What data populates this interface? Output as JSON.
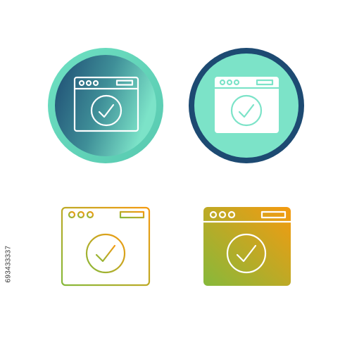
{
  "stock_id": "693433337",
  "icons": [
    {
      "name": "browser-check-icon",
      "style": "gradient-circle-outline"
    },
    {
      "name": "browser-check-icon",
      "style": "mint-circle-navy-ring"
    },
    {
      "name": "browser-check-icon",
      "style": "gradient-outline"
    },
    {
      "name": "browser-check-icon",
      "style": "gradient-filled"
    }
  ],
  "colors": {
    "teal": "#6ee0c2",
    "navy": "#1d4a72",
    "mint": "#7ce3c8",
    "green": "#86b93b",
    "orange": "#f59a10"
  }
}
